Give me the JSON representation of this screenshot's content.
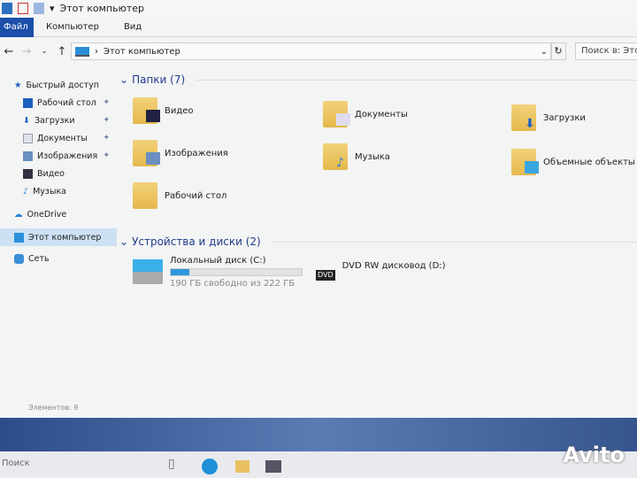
{
  "window": {
    "title": "Этот компьютер"
  },
  "ribbon": {
    "tabs": [
      "Файл",
      "Компьютер",
      "Вид"
    ]
  },
  "address": {
    "path": "Этот компьютер",
    "search_placeholder": "Поиск в: Этот компьютер"
  },
  "sidebar": {
    "items": [
      {
        "label": "Быстрый доступ"
      },
      {
        "label": "Рабочий стол",
        "pinned": true
      },
      {
        "label": "Загрузки",
        "pinned": true
      },
      {
        "label": "Документы",
        "pinned": true
      },
      {
        "label": "Изображения",
        "pinned": true
      },
      {
        "label": "Видео"
      },
      {
        "label": "Музыка"
      },
      {
        "label": "OneDrive"
      },
      {
        "label": "Этот компьютер",
        "selected": true
      },
      {
        "label": "Сеть"
      }
    ]
  },
  "folders": {
    "header": "Папки (7)",
    "items": [
      "Видео",
      "Документы",
      "Загрузки",
      "Изображения",
      "Музыка",
      "Объемные объекты",
      "Рабочий стол"
    ]
  },
  "drives": {
    "header": "Устройства и диски (2)",
    "items": [
      {
        "name": "Локальный диск (C:)",
        "free": "190 ГБ свободно из 222 ГБ",
        "used_fraction": 0.14
      },
      {
        "name": "DVD RW дисковод (D:)",
        "badge": "DVD"
      }
    ]
  },
  "status": {
    "count": "Элементов: 9"
  },
  "taskbar": {
    "search": "Поиск"
  },
  "watermark": "Avito",
  "colors": {
    "accent": "#1c4fa8",
    "bar": "#2c97dc"
  }
}
